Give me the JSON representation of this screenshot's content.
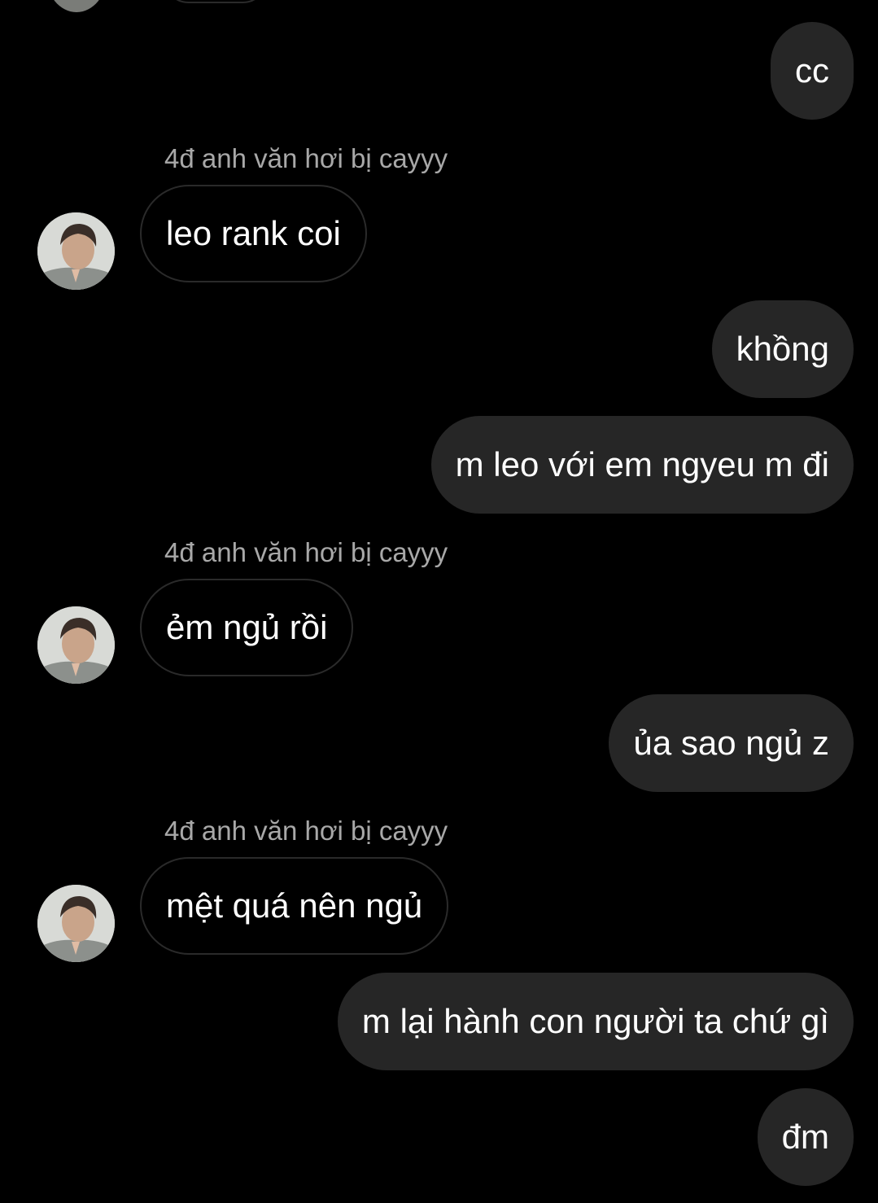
{
  "thread": {
    "background_color": "#000000",
    "outgoing_bubble_color": "#262626",
    "incoming_bubble_border": "#2a2a2a",
    "sender_label_color": "#a8a8a8",
    "messages": [
      {
        "direction": "outgoing",
        "text": "cc"
      },
      {
        "direction": "incoming",
        "sender": "4đ anh văn hơi bị cayyy",
        "text": "leo rank coi"
      },
      {
        "direction": "outgoing",
        "text": "khồng"
      },
      {
        "direction": "outgoing",
        "text": "m leo với em ngyeu m đi"
      },
      {
        "direction": "incoming",
        "sender": "4đ anh văn hơi bị cayyy",
        "text": "ẻm ngủ rồi"
      },
      {
        "direction": "outgoing",
        "text": "ủa sao ngủ z"
      },
      {
        "direction": "incoming",
        "sender": "4đ anh văn hơi bị cayyy",
        "text": "mệt quá nên ngủ"
      },
      {
        "direction": "outgoing",
        "text": "m lại hành con người ta chứ gì"
      },
      {
        "direction": "outgoing",
        "text": "đm"
      }
    ]
  },
  "icons": {
    "avatar": "user-avatar-photo"
  }
}
